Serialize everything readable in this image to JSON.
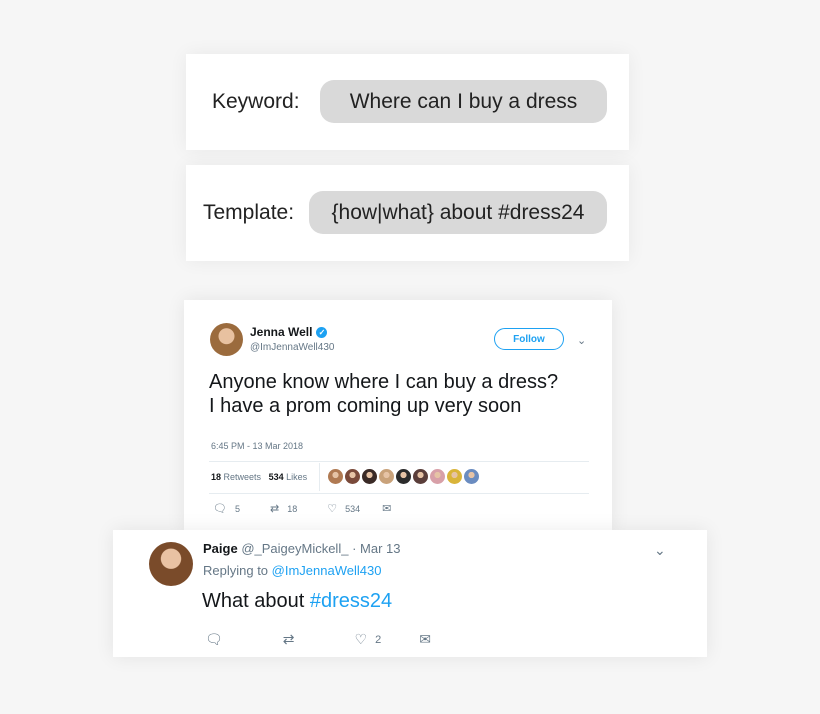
{
  "keyword": {
    "label": "Keyword:",
    "value": "Where can I buy a dress"
  },
  "template": {
    "label": "Template:",
    "value": "{how|what} about #dress24"
  },
  "tweet": {
    "name": "Jenna Well",
    "handle": "@ImJennaWell430",
    "follow_label": "Follow",
    "text_line1": "Anyone know where I can buy a dress?",
    "text_line2": "I have a prom coming up very soon",
    "timestamp": "6:45 PM - 13 Mar 2018",
    "retweets_count": "18",
    "retweets_label": "Retweets",
    "likes_count": "534",
    "likes_label": "Likes",
    "reply_count": "5",
    "retweet_count": "18",
    "like_count": "534",
    "liker_colors": [
      "#b07a52",
      "#7a4a3a",
      "#3a2a26",
      "#c9a27a",
      "#2b2b2b",
      "#5a3e3a",
      "#d8a0a8",
      "#d9b43a",
      "#6a8cc0"
    ],
    "icons": [
      "reply-icon",
      "retweet-icon",
      "heart-icon",
      "mail-icon",
      "chevron-down-icon",
      "verified-icon"
    ]
  },
  "reply": {
    "name": "Paige",
    "handle": "@_PaigeyMickell_",
    "separator": "·",
    "date": "Mar 13",
    "replying_prefix": "Replying to",
    "replying_handle": "@ImJennaWell430",
    "text_plain": "What about ",
    "text_hashtag": "#dress24",
    "like_count": "2"
  },
  "colors": {
    "accent": "#1da1f2",
    "pill": "#d9d9d9",
    "muted": "#657786"
  }
}
